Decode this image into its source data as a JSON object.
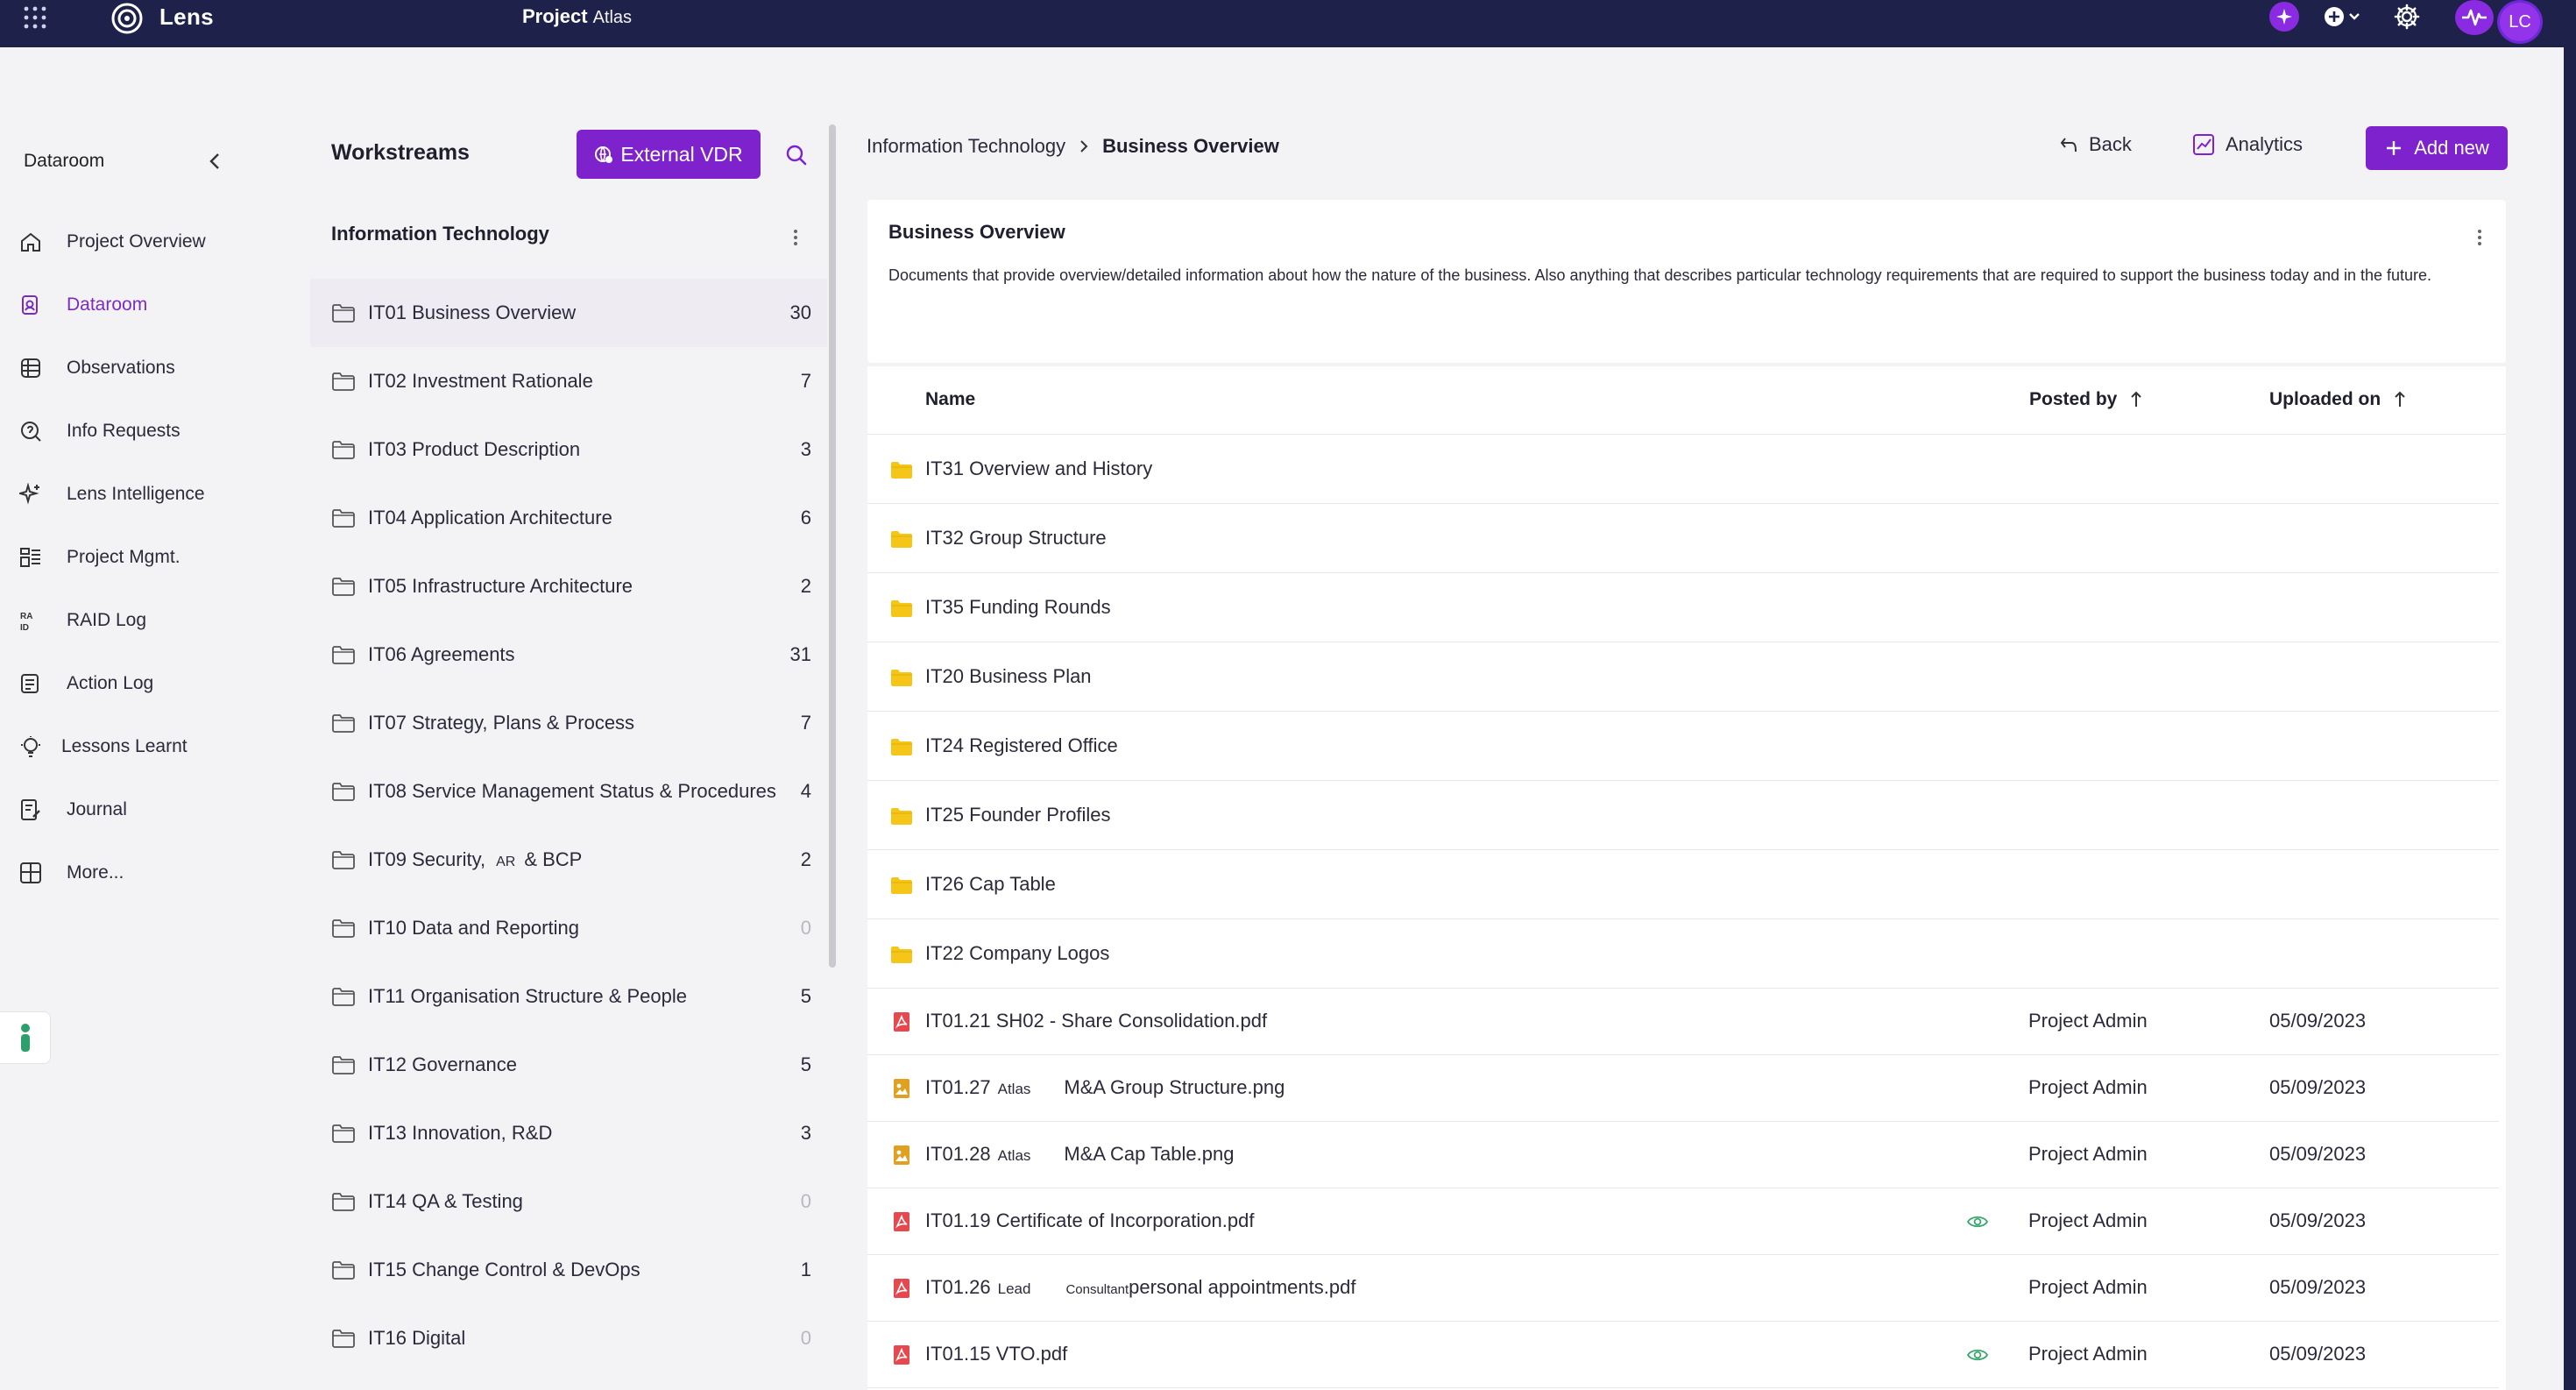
{
  "topbar": {
    "brand": "Lens",
    "project_label": "Project",
    "project_name": "Atlas",
    "avatar_initials": "LC"
  },
  "nav": {
    "header": "Dataroom",
    "items": [
      {
        "label": "Project Overview",
        "icon": "home-icon"
      },
      {
        "label": "Dataroom",
        "icon": "dataroom-icon",
        "active": true
      },
      {
        "label": "Observations",
        "icon": "observations-icon"
      },
      {
        "label": "Info Requests",
        "icon": "info-requests-icon"
      },
      {
        "label": "Lens Intelligence",
        "icon": "sparkle-icon"
      },
      {
        "label": "Project Mgmt.",
        "icon": "project-mgmt-icon"
      },
      {
        "label": "RAID Log",
        "icon": "raid-icon"
      },
      {
        "label": "Action Log",
        "icon": "action-log-icon"
      },
      {
        "label": "Lessons Learnt",
        "icon": "lightbulb-icon"
      },
      {
        "label": "Journal",
        "icon": "journal-icon"
      },
      {
        "label": "More...",
        "icon": "more-icon"
      }
    ]
  },
  "workstreams": {
    "title": "Workstreams",
    "external_vdr_label": "External VDR",
    "group": "Information Technology",
    "items": [
      {
        "label": "IT01 Business Overview",
        "count": "30",
        "active": true
      },
      {
        "label": "IT02 Investment Rationale",
        "count": "7"
      },
      {
        "label": "IT03 Product Description",
        "count": "3"
      },
      {
        "label": "IT04 Application Architecture",
        "count": "6"
      },
      {
        "label": "IT05 Infrastructure Architecture",
        "count": "2"
      },
      {
        "label": "IT06 Agreements",
        "count": "31"
      },
      {
        "label": "IT07 Strategy, Plans & Process",
        "count": "7"
      },
      {
        "label": "IT08 Service Management Status & Procedures",
        "count": "4"
      },
      {
        "label": "IT09 Security,",
        "label_tag": "AR",
        "label_rest": "& BCP",
        "count": "2"
      },
      {
        "label": "IT10 Data and Reporting",
        "count": "0"
      },
      {
        "label": "IT11 Organisation Structure & People",
        "count": "5"
      },
      {
        "label": "IT12 Governance",
        "count": "5"
      },
      {
        "label": "IT13 Innovation, R&D",
        "count": "3"
      },
      {
        "label": "IT14 QA & Testing",
        "count": "0"
      },
      {
        "label": "IT15 Change Control & DevOps",
        "count": "1"
      },
      {
        "label": "IT16 Digital",
        "count": "0"
      }
    ]
  },
  "main": {
    "breadcrumb": {
      "parent": "Information Technology",
      "current": "Business Overview"
    },
    "back_label": "Back",
    "analytics_label": "Analytics",
    "add_new_label": "Add new",
    "card": {
      "title": "Business Overview",
      "description": "Documents that provide overview/detailed information about how the nature of the business. Also anything that describes particular technology requirements that are required to support the business today and in the future."
    },
    "table": {
      "columns": {
        "name": "Name",
        "posted_by": "Posted by",
        "uploaded_on": "Uploaded on"
      },
      "folders": [
        "IT31 Overview and History",
        "IT32 Group Structure",
        "IT35 Funding Rounds",
        "IT20 Business Plan",
        "IT24 Registered Office",
        "IT25 Founder Profiles",
        "IT26 Cap Table",
        "IT22 Company Logos"
      ],
      "files": [
        {
          "name": "IT01.21 SH02 - Share Consolidation.pdf",
          "type": "pdf",
          "posted_by": "Project Admin",
          "uploaded_on": "05/09/2023",
          "viewed": false
        },
        {
          "name": "IT01.27",
          "tag": "Atlas",
          "rest": "M&A Group Structure.png",
          "type": "image",
          "posted_by": "Project Admin",
          "uploaded_on": "05/09/2023",
          "viewed": false
        },
        {
          "name": "IT01.28",
          "tag": "Atlas",
          "rest": "M&A Cap Table.png",
          "type": "image",
          "posted_by": "Project Admin",
          "uploaded_on": "05/09/2023",
          "viewed": false
        },
        {
          "name": "IT01.19 Certificate of Incorporation.pdf",
          "type": "pdf",
          "posted_by": "Project Admin",
          "uploaded_on": "05/09/2023",
          "viewed": true
        },
        {
          "name": "IT01.26",
          "tag": "Lead",
          "tag2": "Consultant",
          "rest": "personal appointments.pdf",
          "type": "pdf",
          "posted_by": "Project Admin",
          "uploaded_on": "05/09/2023",
          "viewed": false
        },
        {
          "name": "IT01.15 VTO.pdf",
          "type": "pdf",
          "posted_by": "Project Admin",
          "uploaded_on": "05/09/2023",
          "viewed": true
        }
      ]
    }
  },
  "colors": {
    "topbar": "#1e2149",
    "accent": "#7e22ce",
    "folder": "#f5c518",
    "pdf": "#e5484d",
    "image": "#e0a020",
    "viewed": "#3aa76d"
  }
}
